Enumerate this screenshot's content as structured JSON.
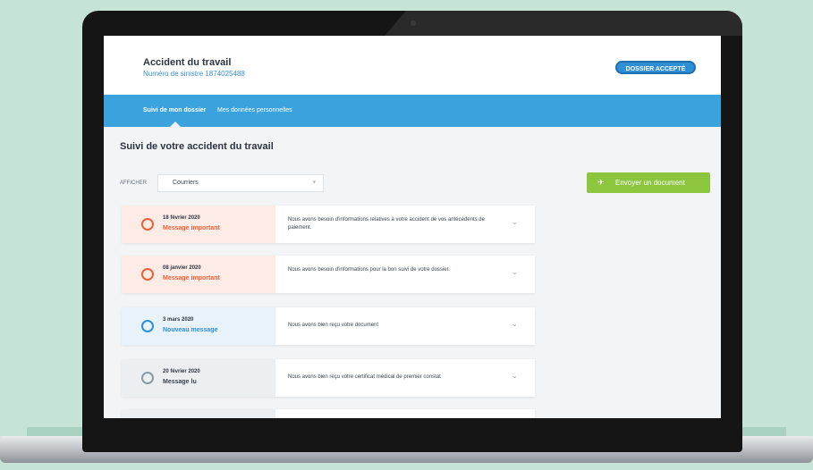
{
  "app": {
    "title": "Accident du travail",
    "subtitle": "Numéro de sinistre 1874025488",
    "status_button": "DOSSIER ACCEPTÉ"
  },
  "tabs": [
    {
      "label": "Suivi de mon dossier",
      "active": true
    },
    {
      "label": "Mes données personnelles",
      "active": false
    }
  ],
  "main": {
    "section_title": "Suivi de votre accident du travail",
    "filter": {
      "label": "AFFICHER",
      "value": "Courriers"
    },
    "send_button": {
      "label": "Envoyer un document",
      "icon": "paper-plane-icon"
    }
  },
  "messages": [
    {
      "kind": "important",
      "date": "18 février 2020",
      "type": "Message important",
      "text": "Nous avons besoin d'informations relatives à votre accident de vos antécédents de paiement.",
      "icon": "alert-circle-icon"
    },
    {
      "kind": "important",
      "date": "08 janvier 2020",
      "type": "Message important",
      "text": "Nous avons besoin d'informations pour la bon suivi de votre dossier.",
      "icon": "alert-circle-icon"
    },
    {
      "kind": "new",
      "date": "3 mars 2020",
      "type": "Nouveau message",
      "text": "Nous avons bien reçu votre document",
      "icon": "new-message-icon"
    },
    {
      "kind": "read",
      "date": "20 février 2020",
      "type": "Message lu",
      "text": "Nous avons bien reçu votre certificat médical de premier constat",
      "icon": "read-message-icon"
    }
  ],
  "colors": {
    "accent_blue": "#3aa3de",
    "important": "#e8623a",
    "send_green": "#8cc63f",
    "background": "#c5e3d6"
  }
}
